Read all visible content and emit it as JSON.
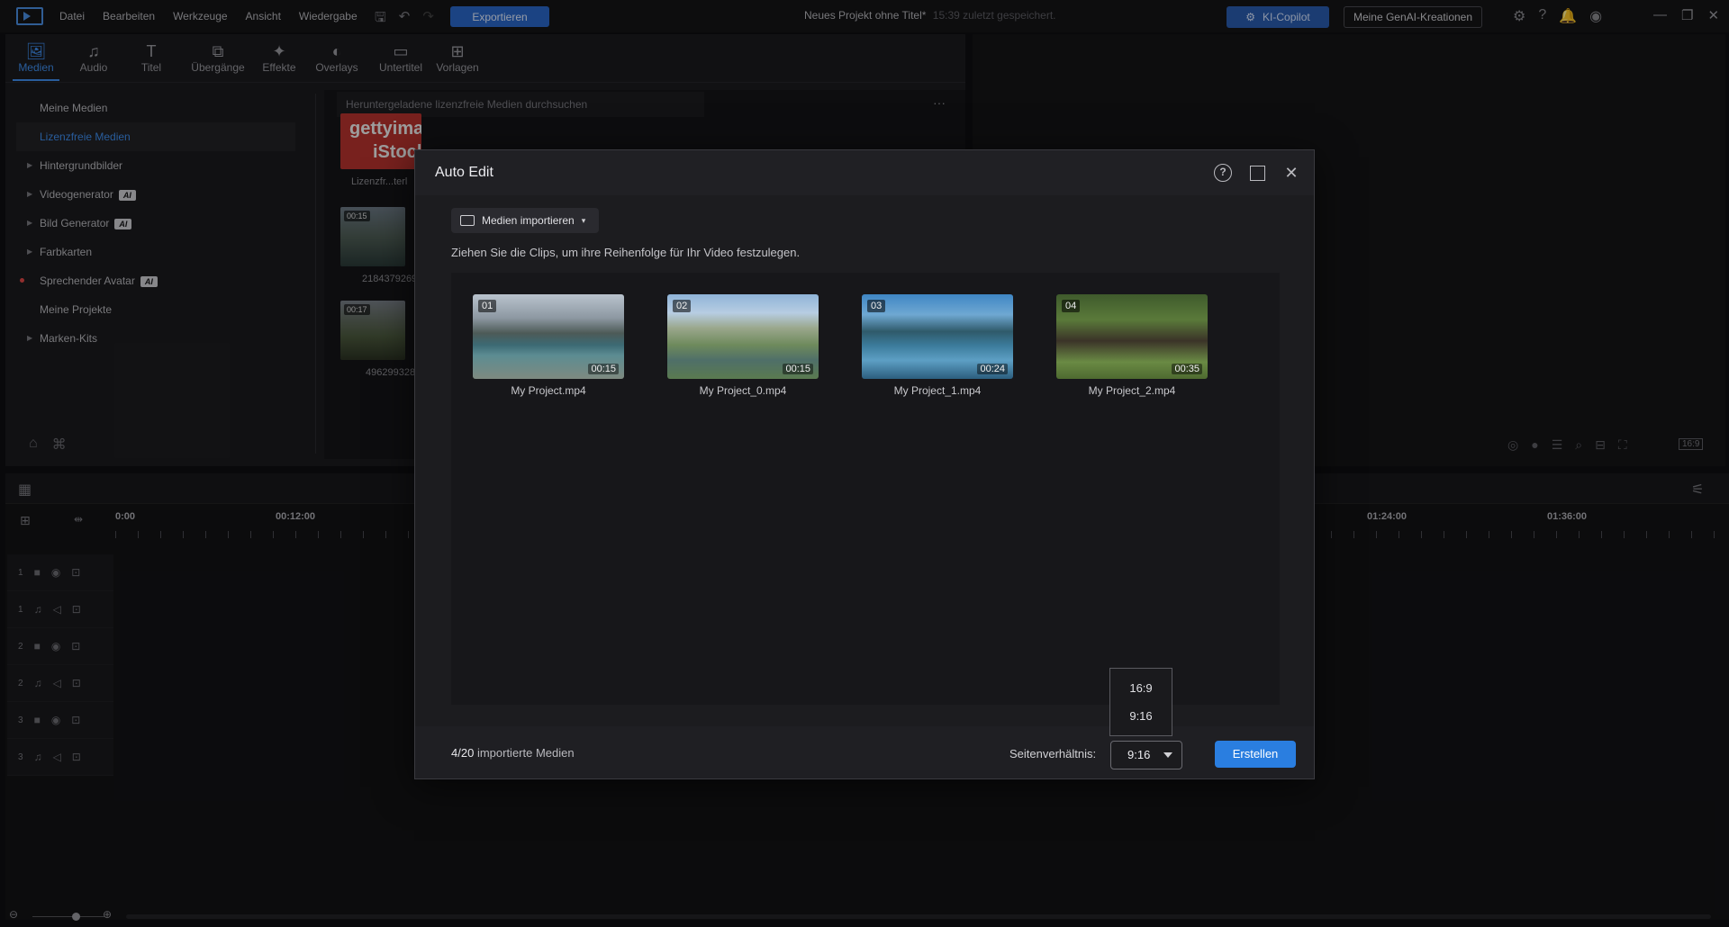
{
  "menu": {
    "items": [
      "Datei",
      "Bearbeiten",
      "Werkzeuge",
      "Ansicht",
      "Wiedergabe"
    ],
    "export_label": "Exportieren",
    "project_title": "Neues Projekt ohne Titel*",
    "saved_status": "15:39 zuletzt gespeichert.",
    "copilot_label": "KI-Copilot",
    "genai_label": "Meine GenAI-Kreationen"
  },
  "library": {
    "tabs": [
      "Medien",
      "Audio",
      "Titel",
      "Übergänge",
      "Effekte",
      "Overlays",
      "Untertitel",
      "Vorlagen"
    ],
    "tree": [
      {
        "label": "Meine Medien"
      },
      {
        "label": "Lizenzfreie Medien"
      },
      {
        "label": "Hintergrundbilder"
      },
      {
        "label": "Videogenerator",
        "badge": "AI"
      },
      {
        "label": "Bild Generator",
        "badge": "AI"
      },
      {
        "label": "Farbkarten"
      },
      {
        "label": "Sprechender Avatar",
        "badge": "AI"
      },
      {
        "label": "Meine Projekte"
      },
      {
        "label": "Marken-Kits"
      }
    ],
    "search_placeholder": "Heruntergeladene lizenzfreie Medien durchsuchen",
    "getty_line1": "gettyima",
    "getty_line2": "iStock",
    "getty_caption": "Lizenzfr...terl",
    "thumb1_duration": "00:15",
    "thumb1_caption": "2184379269_",
    "thumb2_duration": "00:17",
    "thumb2_caption": "496299328_"
  },
  "preview": {
    "ratio": "16:9"
  },
  "timeline": {
    "ruler_labels": [
      "0:00",
      "00:12:00",
      "01:24:00",
      "01:36:00"
    ],
    "tracks": [
      "1",
      "1",
      "2",
      "2",
      "3",
      "3"
    ]
  },
  "modal": {
    "title": "Auto Edit",
    "import_label": "Medien importieren",
    "instruction": "Ziehen Sie die Clips, um ihre Reihenfolge für Ihr Video festzulegen.",
    "clips": [
      {
        "num": "01",
        "duration": "00:15",
        "name": "My Project.mp4"
      },
      {
        "num": "02",
        "duration": "00:15",
        "name": "My Project_0.mp4"
      },
      {
        "num": "03",
        "duration": "00:24",
        "name": "My Project_1.mp4"
      },
      {
        "num": "04",
        "duration": "00:35",
        "name": "My Project_2.mp4"
      }
    ],
    "media_count": "4/20",
    "media_count_suffix": "importierte Medien",
    "aspect_label": "Seitenverhältnis:",
    "aspect_value": "9:16",
    "aspect_options": [
      "16:9",
      "9:16"
    ],
    "create_label": "Erstellen"
  },
  "colors": {
    "accent": "#2a7ee0",
    "background": "#0f0f11",
    "modal_bg": "#1c1c1f"
  }
}
